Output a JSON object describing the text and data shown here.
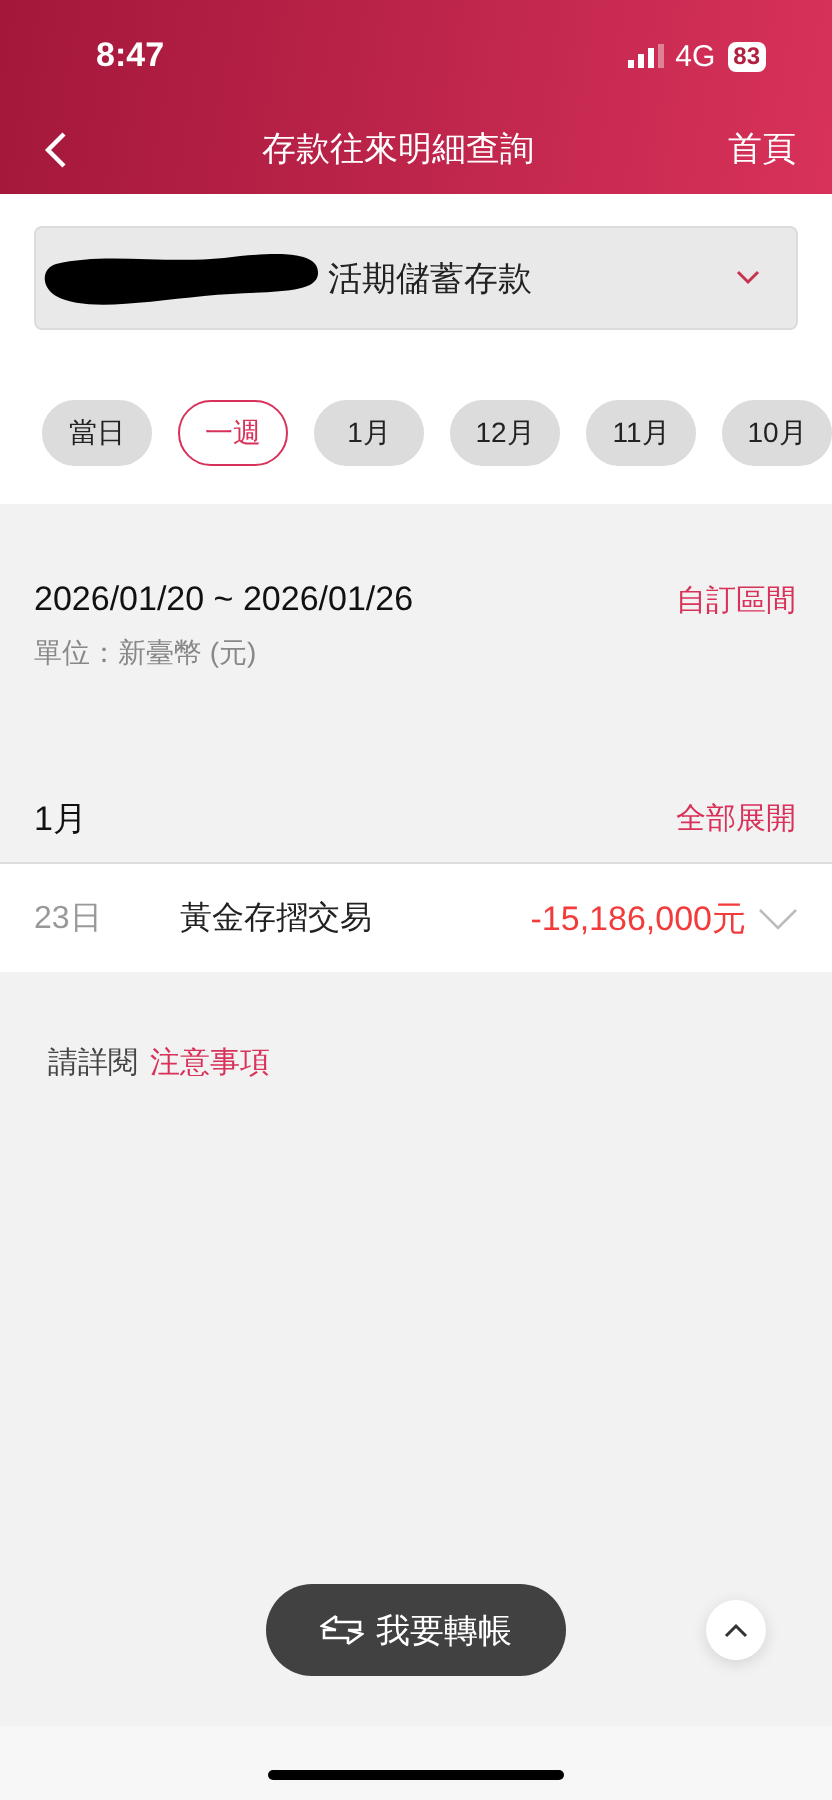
{
  "status_bar": {
    "time": "8:47",
    "network": "4G",
    "battery": "83"
  },
  "nav": {
    "title": "存款往來明細查詢",
    "home": "首頁"
  },
  "account": {
    "name": "活期儲蓄存款"
  },
  "periods": [
    {
      "label": "當日",
      "selected": false
    },
    {
      "label": "一週",
      "selected": true
    },
    {
      "label": "1月",
      "selected": false
    },
    {
      "label": "12月",
      "selected": false
    },
    {
      "label": "11月",
      "selected": false
    },
    {
      "label": "10月",
      "selected": false
    }
  ],
  "range": {
    "dates": "2026/01/20 ~ 2026/01/26",
    "custom": "自訂區間",
    "unit": "單位：新臺幣 (元)"
  },
  "month": {
    "label": "1月",
    "expand_all": "全部展開"
  },
  "transactions": [
    {
      "day": "23日",
      "description": "黃金存摺交易",
      "amount": "-15,186,000元"
    }
  ],
  "notice": {
    "prefix": "請詳閱",
    "link": "注意事項"
  },
  "transfer_button": "我要轉帳"
}
